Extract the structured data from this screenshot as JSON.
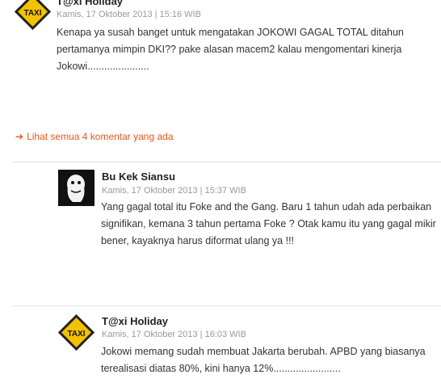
{
  "comments": [
    {
      "author": "T@xi Holiday",
      "date": "Kamis, 17 Oktober 2013 | 15:16 WIB",
      "text": "Kenapa ya susah banget untuk mengatakan JOKOWI GAGAL TOTAL ditahun pertamanya mimpin DKI?? pake alasan macem2 kalau mengomentari kinerja Jokowi......................",
      "avatar": "taxi-sign-icon"
    }
  ],
  "see_all": {
    "arrow": "➔",
    "label": "Lihat semua 4 komentar yang ada"
  },
  "replies": [
    {
      "author": "Bu Kek Siansu",
      "date": "Kamis, 17 Oktober 2013 | 15:37 WIB",
      "text": "Yang gagal total itu Foke and the Gang. Baru 1 tahun udah ada perbaikan signifikan, kemana 3 tahun pertama Foke ? Otak kamu itu yang gagal mikir bener, kayaknya harus diformat ulang ya !!!",
      "avatar": "cartoon-face-avatar"
    },
    {
      "author": "T@xi Holiday",
      "date": "Kamis, 17 Oktober 2013 | 16:03 WIB",
      "text": "Jokowi memang sudah membuat Jakarta berubah. APBD yang biasanya terealisasi diatas 80%, kini hanya 12%........................",
      "avatar": "taxi-sign-icon"
    }
  ],
  "colors": {
    "link": "#e8561c",
    "taxi_yellow": "#f3c200",
    "meta": "#999999"
  }
}
